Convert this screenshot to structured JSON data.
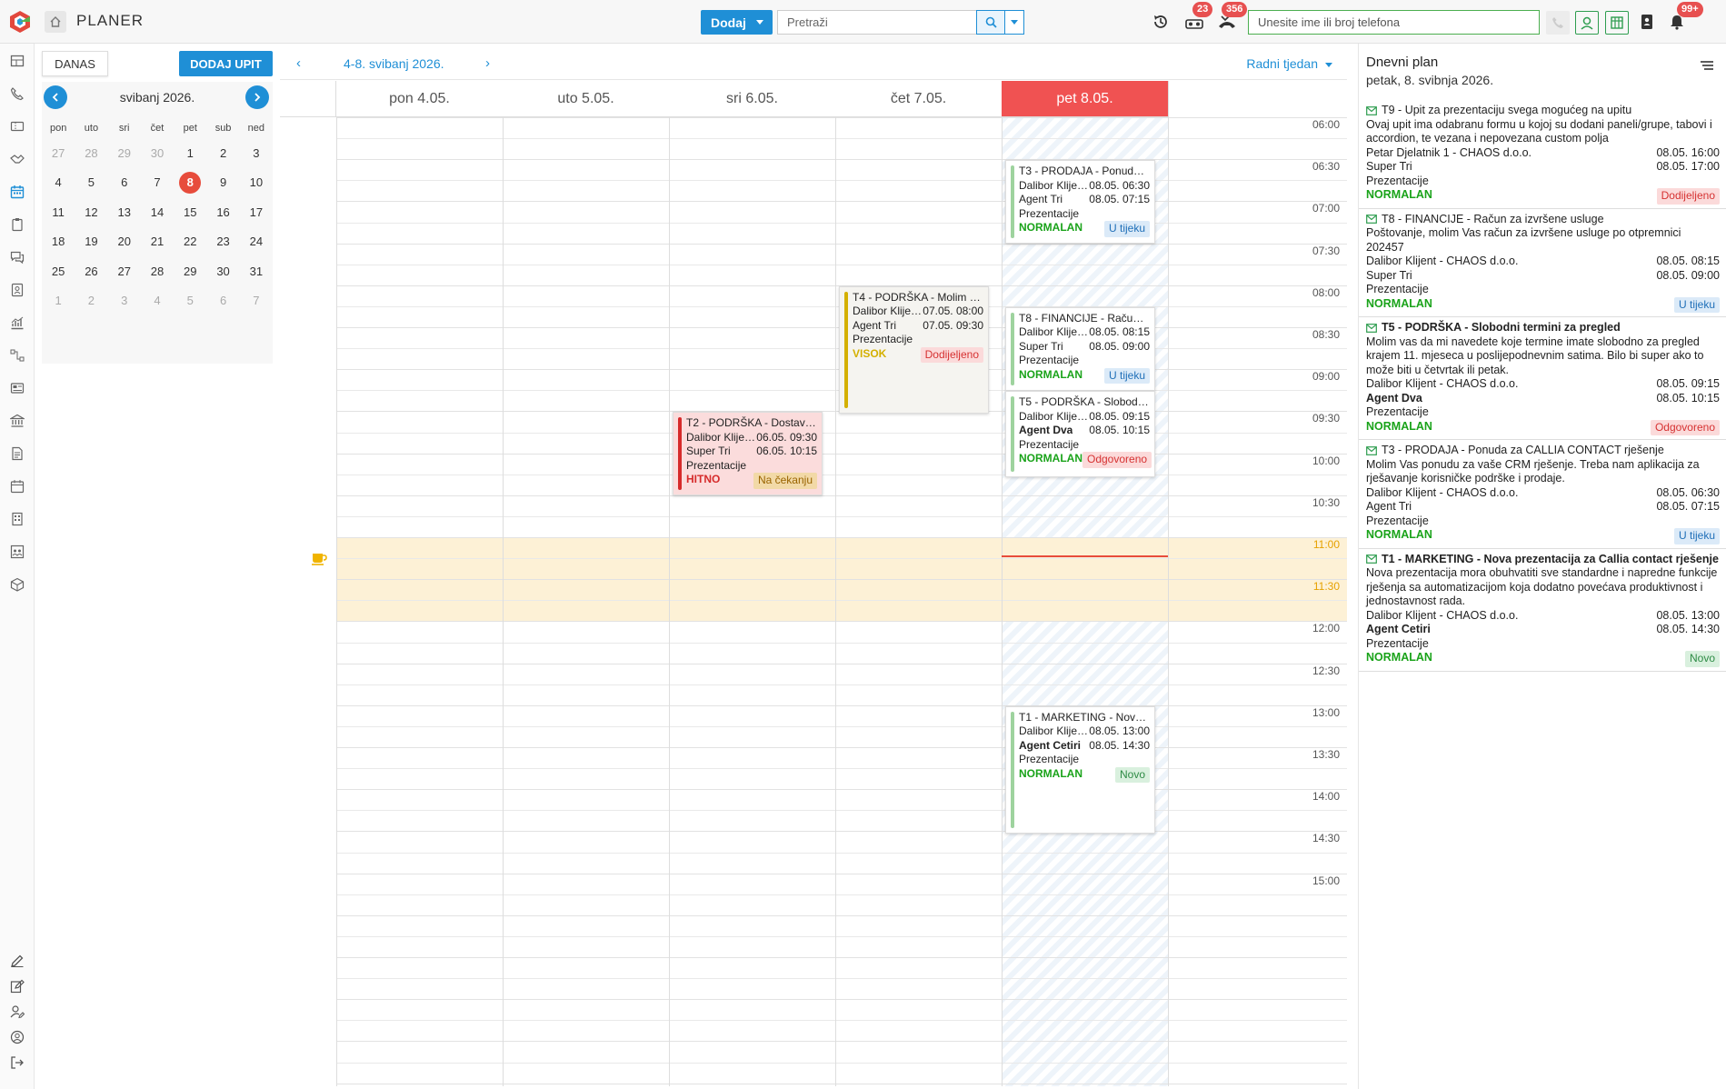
{
  "app": {
    "title": "PLANER"
  },
  "toolbar": {
    "dodaj_label": "Dodaj",
    "search_placeholder": "Pretraži",
    "phone_placeholder": "Unesite ime ili broj telefona",
    "badge_tasks": "23",
    "badge_calls": "356",
    "badge_notifications": "99+"
  },
  "mini_calendar": {
    "today_label": "DANAS",
    "add_label": "DODAJ UPIT",
    "month": "svibanj 2026.",
    "weekdays": [
      "pon",
      "uto",
      "sri",
      "čet",
      "pet",
      "sub",
      "ned"
    ],
    "weeks": [
      [
        "27",
        "28",
        "29",
        "30",
        "1",
        "2",
        "3"
      ],
      [
        "4",
        "5",
        "6",
        "7",
        "8",
        "9",
        "10"
      ],
      [
        "11",
        "12",
        "13",
        "14",
        "15",
        "16",
        "17"
      ],
      [
        "18",
        "19",
        "20",
        "21",
        "22",
        "23",
        "24"
      ],
      [
        "25",
        "26",
        "27",
        "28",
        "29",
        "30",
        "31"
      ],
      [
        "1",
        "2",
        "3",
        "4",
        "5",
        "6",
        "7"
      ]
    ],
    "selected_day": "8"
  },
  "calendar": {
    "range": "4-8. svibanj 2026.",
    "view": "Radni tjedan",
    "days": [
      "pon 4.05.",
      "uto 5.05.",
      "sri 6.05.",
      "čet 7.05.",
      "pet 8.05."
    ],
    "today_index": 4,
    "times": [
      "06:00",
      "06:30",
      "07:00",
      "07:30",
      "08:00",
      "08:30",
      "09:00",
      "09:30",
      "10:00",
      "10:30",
      "11:00",
      "11:30",
      "12:00",
      "12:30",
      "13:00",
      "13:30",
      "14:00",
      "14:30",
      "15:00"
    ],
    "events": [
      {
        "title": "T3 - PRODAJA - Ponuda za CAL...",
        "client": "Dalibor Klijent - C...",
        "start": "08.05. 06:30",
        "agent": "Agent Tri",
        "end": "08.05. 07:15",
        "type": "Prezentacije",
        "priority": "NORMALAN",
        "status": "U tijeku"
      },
      {
        "title": "T4 - PODRŠKA - Molim vas do...",
        "client": "Dalibor Klijent - C...",
        "start": "07.05. 08:00",
        "agent": "Agent Tri",
        "end": "07.05. 09:30",
        "type": "Prezentacije",
        "priority": "VISOK",
        "status": "Dodijeljeno"
      },
      {
        "title": "T8 - FINANCIJE - Račun za izvrš...",
        "client": "Dalibor Klijent - C...",
        "start": "08.05. 08:15",
        "agent": "Super Tri",
        "end": "08.05. 09:00",
        "type": "Prezentacije",
        "priority": "NORMALAN",
        "status": "U tijeku"
      },
      {
        "title": "T5 - PODRŠKA - Slobodni ter...",
        "client": "Dalibor Klijent - C...",
        "start": "08.05. 09:15",
        "agent": "Agent Dva",
        "end": "08.05. 10:15",
        "type": "Prezentacije",
        "priority": "NORMALAN",
        "status": "Odgovoreno"
      },
      {
        "title": "T2 - PODRŠKA - Dostavna služ...",
        "client": "Dalibor Klijent - C...",
        "start": "06.05. 09:30",
        "agent": "Super Tri",
        "end": "06.05. 10:15",
        "type": "Prezentacije",
        "priority": "HITNO",
        "status": "Na čekanju"
      },
      {
        "title": "T1 - MARKETING - Nova prez...",
        "client": "Dalibor Klijent - C...",
        "start": "08.05. 13:00",
        "agent": "Agent Cetiri",
        "end": "08.05. 14:30",
        "type": "Prezentacije",
        "priority": "NORMALAN",
        "status": "Novo"
      }
    ]
  },
  "daily_plan": {
    "title": "Dnevni plan",
    "date": "petak, 8. svibnja 2026.",
    "items": [
      {
        "title": "T9 - Upit za prezentaciju svega mogućeg na upitu",
        "desc": "Ovaj upit ima odabranu formu u kojoj su dodani paneli/grupe, tabovi i accordion, te vezana i nepovezana custom polja",
        "client": "Petar Djelatnik 1 - CHAOS d.o.o.",
        "start": "08.05. 16:00",
        "agent": "Super Tri",
        "end": "08.05. 17:00",
        "type": "Prezentacije",
        "priority": "NORMALAN",
        "status": "Dodijeljeno"
      },
      {
        "title": "T8 - FINANCIJE - Račun za izvršene usluge",
        "desc": "Poštovanje, molim Vas račun za izvršene usluge po otpremnici 202457",
        "client": "Dalibor Klijent - CHAOS d.o.o.",
        "start": "08.05. 08:15",
        "agent": "Super Tri",
        "end": "08.05. 09:00",
        "type": "Prezentacije",
        "priority": "NORMALAN",
        "status": "U tijeku"
      },
      {
        "title": "T5 - PODRŠKA - Slobodni termini za pregled",
        "desc": "Molim vas da mi navedete koje termine imate slobodno za pregled krajem 11. mjeseca u poslijepodnevnim satima. Bilo bi super ako to može biti u četvrtak ili petak.",
        "client": "Dalibor Klijent - CHAOS d.o.o.",
        "start": "08.05. 09:15",
        "agent": "Agent Dva",
        "end": "08.05. 10:15",
        "type": "Prezentacije",
        "priority": "NORMALAN",
        "status": "Odgovoreno"
      },
      {
        "title": "T3 - PRODAJA - Ponuda za CALLIA CONTACT rješenje",
        "desc": "Molim Vas ponudu za vaše CRM rješenje. Treba nam aplikacija za rješavanje korisničke podrške i prodaje.",
        "client": "Dalibor Klijent - CHAOS d.o.o.",
        "start": "08.05. 06:30",
        "agent": "Agent Tri",
        "end": "08.05. 07:15",
        "type": "Prezentacije",
        "priority": "NORMALAN",
        "status": "U tijeku"
      },
      {
        "title": "T1 - MARKETING - Nova prezentacija za Callia contact rješenje",
        "desc": "Nova prezentacija mora obuhvatiti sve standardne i napredne funkcije rješenja sa automatizacijom koja dodatno povećava produktivnost i jednostavnost rada.",
        "client": "Dalibor Klijent - CHAOS d.o.o.",
        "start": "08.05. 13:00",
        "agent": "Agent Cetiri",
        "end": "08.05. 14:30",
        "type": "Prezentacije",
        "priority": "NORMALAN",
        "status": "Novo"
      }
    ]
  },
  "colors": {
    "accent": "#1f8fd6",
    "today_header": "#f05252",
    "priority_normal": "#1aa31a",
    "priority_high": "#d4b000",
    "priority_urgent": "#d62b2b",
    "break_band": "#fdf1d6"
  },
  "icons": {
    "logo": "app-logo",
    "home": "home-icon",
    "history": "history-icon",
    "tasks": "voicemail-icon",
    "calls": "missed-call-icon",
    "notifications": "bell-icon",
    "break": "coffee-icon"
  }
}
